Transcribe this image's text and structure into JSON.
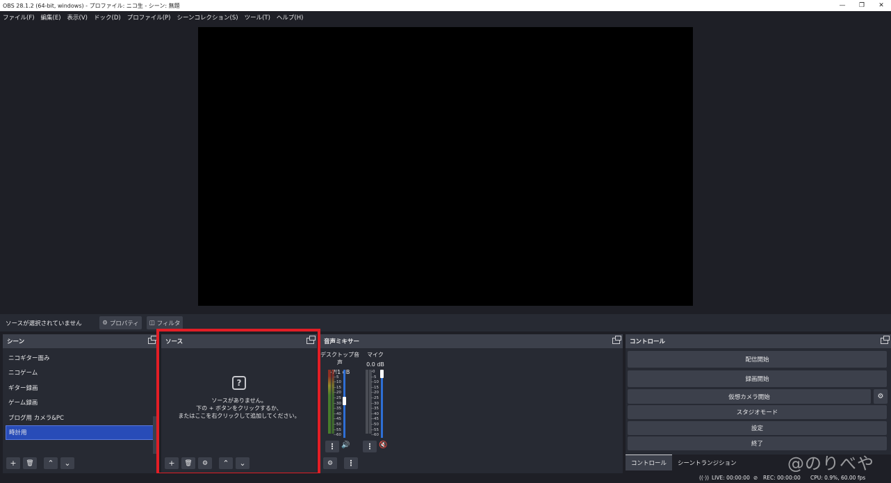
{
  "window": {
    "title": "OBS 28.1.2 (64-bit, windows) - プロファイル: ニコ生 - シーン: 無題",
    "min_icon": "minimize-icon",
    "restore_icon": "restore-icon",
    "close_icon": "close-icon"
  },
  "menu": [
    "ファイル(F)",
    "編集(E)",
    "表示(V)",
    "ドック(D)",
    "プロファイル(P)",
    "シーンコレクション(S)",
    "ツール(T)",
    "ヘルプ(H)"
  ],
  "source_toolbar": {
    "no_selection": "ソースが選択されていません",
    "properties": "プロパティ",
    "filters": "フィルタ"
  },
  "scenes": {
    "title": "シーン",
    "items": [
      "ニコギター面み",
      "ニコゲーム",
      "ギター録画",
      "ゲーム録画",
      "ブログ用 カメラ&PC",
      "時計用"
    ],
    "selected_index": 5
  },
  "sources": {
    "title": "ソース",
    "empty_line1": "ソースがありません。",
    "empty_line2": "下の + ボタンをクリックするか、",
    "empty_line3": "またはここを右クリックして追加してください。"
  },
  "mixer": {
    "title": "音声ミキサー",
    "channels": [
      {
        "name": "デスクトップ音声",
        "db": "-7.1 dB",
        "level": 0.55,
        "muted": false
      },
      {
        "name": "マイク",
        "db": "0.0 dB",
        "level": 1.0,
        "muted": true
      }
    ],
    "ticks": [
      "0",
      "-5",
      "-10",
      "-15",
      "-20",
      "-25",
      "-30",
      "-35",
      "-40",
      "-45",
      "-50",
      "-55",
      "-60"
    ]
  },
  "controls": {
    "title": "コントロール",
    "start_stream": "配信開始",
    "start_record": "録画開始",
    "start_vcam": "仮想カメラ開始",
    "studio_mode": "スタジオモード",
    "settings": "設定",
    "exit": "終了",
    "tab_controls": "コントロール",
    "tab_transitions": "シーントランジション"
  },
  "status": {
    "live": "LIVE: 00:00:00",
    "rec": "REC: 00:00:00",
    "cpu": "CPU: 0.9%, 60.00 fps"
  },
  "watermark": "@のりべや",
  "colors": {
    "highlight": "#e21e26",
    "selected": "#284cb8",
    "slider": "#2e6fd6"
  }
}
